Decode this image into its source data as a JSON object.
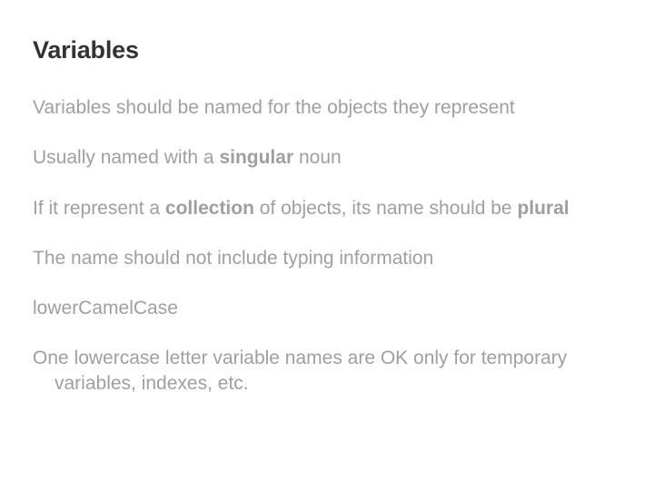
{
  "title": "Variables",
  "items": [
    {
      "segments": [
        {
          "text": "Variables should be named for the objects they represent",
          "strong": false
        }
      ]
    },
    {
      "segments": [
        {
          "text": "Usually named with a ",
          "strong": false
        },
        {
          "text": "singular",
          "strong": true
        },
        {
          "text": " noun",
          "strong": false
        }
      ]
    },
    {
      "segments": [
        {
          "text": "If it represent a ",
          "strong": false
        },
        {
          "text": "collection",
          "strong": true
        },
        {
          "text": " of objects, its name should be ",
          "strong": false
        },
        {
          "text": "plural",
          "strong": true
        }
      ]
    },
    {
      "segments": [
        {
          "text": "The name should not include typing information",
          "strong": false
        }
      ]
    },
    {
      "segments": [
        {
          "text": "lowerCamelCase",
          "strong": false
        }
      ]
    },
    {
      "segments": [
        {
          "text": "One lowercase letter variable names are OK only for temporary variables, indexes, etc.",
          "strong": false
        }
      ]
    }
  ]
}
